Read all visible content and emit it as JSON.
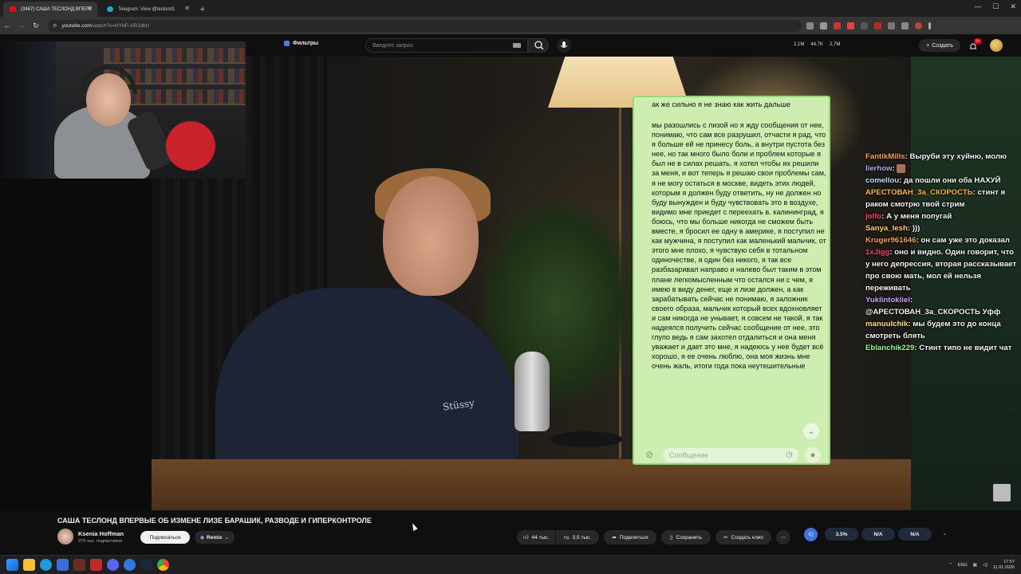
{
  "browser": {
    "tabs": [
      {
        "label": "(3467) САША ТЕСЛОНД ВПЕРВ",
        "active": true,
        "favicon_color": "#ff0000"
      },
      {
        "label": "Telegram: View @teslond1",
        "active": false,
        "favicon_color": "#2aa3e0"
      }
    ],
    "url_host": "youtube.com",
    "url_path": "/watch?v=HYbP-ARJdbU"
  },
  "youtube_header": {
    "filters_label": "Фильтры",
    "search_placeholder": "Введите запрос",
    "stats": [
      "2.1M",
      "44.7K",
      "2.7M"
    ],
    "create_label": "Создать",
    "notifications_badge": "9+"
  },
  "telegram": {
    "header_line": "ак же сильно я не знаю как жить дальше",
    "message": "мы разошлись с лизой но я жду сообщения от нее, понимаю, что сам все разрушил, отчасти я рад, что я больше ей не принесу боль, а внутри пустота без нее, но так много было боли и проблем которые я был не в силах решать, я хотел чтобы их решили за меня, и вот теперь я решаю свои проблемы сам, я не могу остаться в москве, видеть этих людей, которым я должен буду ответить, ну не должен но буду вынужден и буду чувствовать это в воздухе, видимо мне приедет с переехать в. калининград, я боюсь, что мы больше никогда не сможем быть вместе, я бросил ее одну в америке, я поступил не как мужчина, я поступил как маленький мальчик, от этого мне плохо, я чувствую себя в тотальном одиночестве, я один без никого, я так все разбазаривал направо и налево был таким в этом плане легкомысленным что остался ни с чем, я имею в виду денег, еще и лизе должен, а как зарабатывать сейчас не понимаю, я заложник своего образа, мальчик который всех вдохновляет и сам никогда не унывает, я совсем не такой, я так надеялся получить сейчас сообщение от нее, это глупо ведь я сам захотел отдалиться и она меня уважает и дает это мне, я надеюсь у нее будет всё хорошо, я ее очень люблю, она моя жизнь мне очень жаль, итоги года пока неутешительные",
    "input_placeholder": "Сообщение"
  },
  "twitch_chat": [
    {
      "nick": "FantikMills",
      "color": "#ff9f4a",
      "text": "Выруби эту хуйню, молю"
    },
    {
      "nick": "lierhow",
      "color": "#a9a9ff",
      "text": "",
      "emote": true
    },
    {
      "nick": "comellou",
      "color": "#b0e0ff",
      "text": "да пошли они оба НАХУЙ"
    },
    {
      "nick": "АРЕСТОВАН_3а_СКОРОСТЬ",
      "color": "#ffb72f",
      "text": "стинт я раком смотрю твой стрим"
    },
    {
      "nick": "jolfo",
      "color": "#ff3a6a",
      "text": "А у меня попугай"
    },
    {
      "nick": "Sanya_lesh",
      "color": "#ffd34a",
      "text": ")))"
    },
    {
      "nick": "Kruger961646",
      "color": "#ff9f4a",
      "text": "он сам уже это доказал"
    },
    {
      "nick": "1xJigg",
      "color": "#ff3a6a",
      "text": "оно и видно. Один говорит, что у него депрессия, вторая рассказывает про свою мать, мол ей нельзя переживать"
    },
    {
      "nick": "Yuklintokliel",
      "color": "#c9a3ff",
      "text": "@АРЕСТОВАН_3а_СКОРОСТЬ Уфф"
    },
    {
      "nick": "manuulchik",
      "color": "#ffe16a",
      "text": "мы будем это до конца смотреть блять"
    },
    {
      "nick": "Eblanchik229",
      "color": "#8cff8c",
      "text": "Стинт типо не видит чат"
    }
  ],
  "video": {
    "title": "САША ТЕСЛОНД ВПЕРВЫЕ ОБ ИЗМЕНЕ ЛИЗЕ БАРАШИК, РАЗВОДЕ И ГИПЕРКОНТРОЛЕ",
    "channel_name": "Ksenia Hoffman",
    "subscribers": "979 тыс. подписчиков",
    "subscribe_label": "Подписаться",
    "remix_label": "Remix",
    "likes": "44 тыс.",
    "dislikes": "3,5 тыс.",
    "share_label": "Поделиться",
    "save_label": "Сохранить",
    "clip_label": "Создать клип",
    "ext_values": [
      "3.5%",
      "N/A",
      "N/A"
    ]
  },
  "taskbar": {
    "lang": "ENG",
    "time": "17:57",
    "date": "11.01.2026"
  }
}
